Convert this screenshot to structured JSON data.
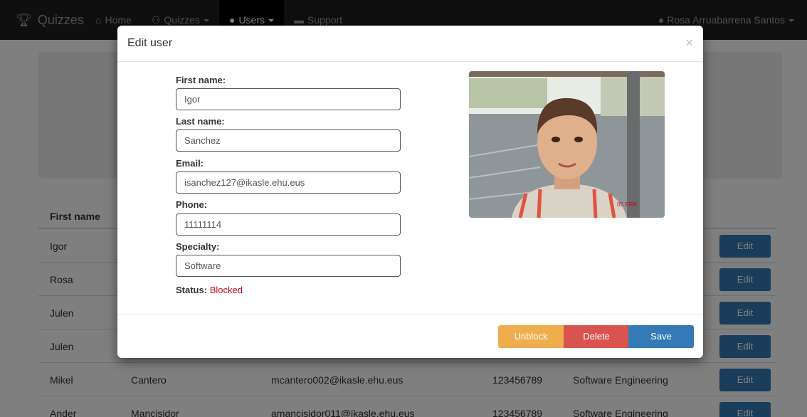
{
  "navbar": {
    "brand": "Quizzes",
    "items": [
      {
        "label": "Home",
        "icon": "home-icon",
        "glyph": "⌂",
        "dropdown": false,
        "active": false
      },
      {
        "label": "Quizzes",
        "icon": "quizzes-icon",
        "glyph": "⚇",
        "dropdown": true,
        "active": false
      },
      {
        "label": "Users",
        "icon": "user-icon",
        "glyph": "●",
        "dropdown": true,
        "active": true
      },
      {
        "label": "Support",
        "icon": "comment-icon",
        "glyph": "▬",
        "dropdown": false,
        "active": false
      }
    ],
    "user": "Rosa Arruabarrena Santos"
  },
  "table": {
    "header_first": "First name",
    "edit_label": "Edit",
    "rows": [
      [
        "Igor",
        "",
        "",
        "",
        ""
      ],
      [
        "Rosa",
        "",
        "",
        "",
        ""
      ],
      [
        "Julen",
        "",
        "",
        "",
        ""
      ],
      [
        "Julen",
        "",
        "",
        "",
        ""
      ],
      [
        "Mikel",
        "Cantero",
        "mcantero002@ikasle.ehu.eus",
        "123456789",
        "Software Engineering"
      ],
      [
        "Ander",
        "Mancisidor",
        "amancisidor011@ikasle.ehu.eus",
        "123456789",
        "Software Engineering"
      ]
    ]
  },
  "modal": {
    "title": "Edit user",
    "close": "×",
    "fields": [
      {
        "label": "First name:",
        "value": "Igor"
      },
      {
        "label": "Last name:",
        "value": "Sanchez"
      },
      {
        "label": "Email:",
        "value": "isanchez127@ikasle.ehu.eus"
      },
      {
        "label": "Phone:",
        "value": "11111114"
      },
      {
        "label": "Specialty:",
        "value": "Software"
      }
    ],
    "status_label": "Status:",
    "status_value": "Blocked",
    "buttons": {
      "unblock": "Unblock",
      "delete": "Delete",
      "save": "Save"
    }
  },
  "colors": {
    "primary": "#337ab7",
    "warning": "#f0ad4e",
    "danger": "#d9534f",
    "status_blocked": "#d0021b"
  }
}
